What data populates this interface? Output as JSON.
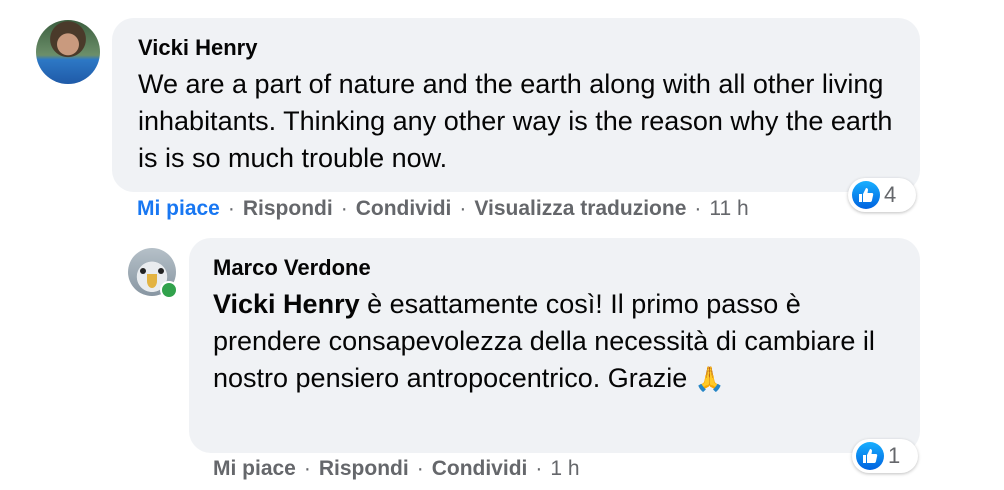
{
  "comments": [
    {
      "author": "Vicki Henry",
      "text": "We are a part of nature and the earth along with all other living inhabitants. Thinking any other way is the reason why the earth is is so much trouble now.",
      "reactions": {
        "icon": "like-icon",
        "count": "4"
      },
      "actions": {
        "like": "Mi piace",
        "reply": "Rispondi",
        "share": "Condividi",
        "translate": "Visualizza traduzione",
        "time": "11 h",
        "separator": "·"
      },
      "liked": true
    },
    {
      "author": "Marco Verdone",
      "mention": "Vicki Henry",
      "text": " è esattamente così! Il primo passo è prendere consapevolezza della necessità di cambiare il nostro pensiero antropocentrico. Grazie ",
      "emoji": "🙏",
      "reactions": {
        "icon": "like-icon",
        "count": "1"
      },
      "actions": {
        "like": "Mi piace",
        "reply": "Rispondi",
        "share": "Condividi",
        "time": "1 h",
        "separator": "·"
      },
      "online": true
    }
  ],
  "colors": {
    "bubble": "#f0f2f5",
    "link_blue": "#1877f2",
    "secondary_text": "#65676b",
    "online_green": "#31a24c"
  }
}
